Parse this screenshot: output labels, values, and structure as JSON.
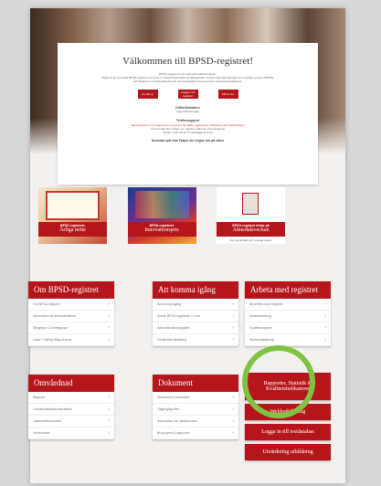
{
  "welcome": {
    "title": "Välkommen till BPSD-registret!",
    "intro_lines": [
      "BPSD-registret är ett nationellt kvalitetsregister.",
      "Syftet är att med stöd BPSD-registret och genom multiprofessionella och åldergärder minska beteendemässiga och psykiska symtom (BPSD)",
      "och därigenom minska lidandet och öka livskvaliteten hos personer med demenssjukdom."
    ],
    "buttons": [
      "Anmäl ny",
      "Logga in till registret",
      "Mitt konto"
    ],
    "driftinfo_title": "Driftinformation",
    "driftinfo_text": "Inga driftstörningar",
    "support_title": "Telefonsupport",
    "support_text": "Telefonsupport och support per e-post om det gäller registrering, utbildning och kvalitetsfrågor",
    "support_text_2": "Vi förmedlar även frågor om registret, åtkomst och inloggning",
    "phone_line": "Telefon: 010- 45 45 75 (Vardagar kl 9-12)",
    "language_line": "Svenska nytt från Fatum de Lingue om på video"
  },
  "promos": [
    {
      "label_small": "BPSD-registrets",
      "label_big": "Årliga möte"
    },
    {
      "label_small": "BPSD-registrets",
      "label_big": "Innovationspris"
    },
    {
      "label_small": "BPSD-registret deltar på",
      "label_big": "Almedalsveckan",
      "caption": "Följ oss på plats och i sociala medier"
    }
  ],
  "cards": {
    "om": {
      "title": "Om BPSD-registret",
      "items": [
        "Om BPSD-registret",
        "Information för tillhandahållare",
        "Styrgrupp & Arbetsgrupp",
        "Lokal + Vanlig fråga-&-svar"
      ]
    },
    "komma_igang": {
      "title": "Att komma igång",
      "items": [
        "Att komma igång",
        "Ansök BPSD-registrets i X-roll",
        "Administratörsuppgifter",
        "Certifierad utbildning"
      ]
    },
    "arbeta": {
      "title": "Arbeta med registret",
      "items": [
        "Att arbeta med registret",
        "Implementering",
        "Kvalitetsregister",
        "Symtomskattning"
      ]
    },
    "omvardnad": {
      "title": "Omvårdnad",
      "items": [
        "Åtgärder",
        "Omvårdnadsdokumentation",
        "Läkemedelsöversikt",
        "Verksamhet"
      ]
    },
    "dokument": {
      "title": "Dokument",
      "items": [
        "Dokument & blanketter",
        "Tillgängliga filer",
        "Information om vårdprocess",
        "Broschyrer & rapporter"
      ]
    }
  },
  "side_buttons": [
    "Rapporter, Statistik & Kvalitetsindikatorer",
    "Webbutbildning",
    "Logga in till testdatabas",
    "Utvärdering utbildning"
  ],
  "colors": {
    "brand_red": "#b5161b",
    "highlight_circle": "#80c342"
  }
}
